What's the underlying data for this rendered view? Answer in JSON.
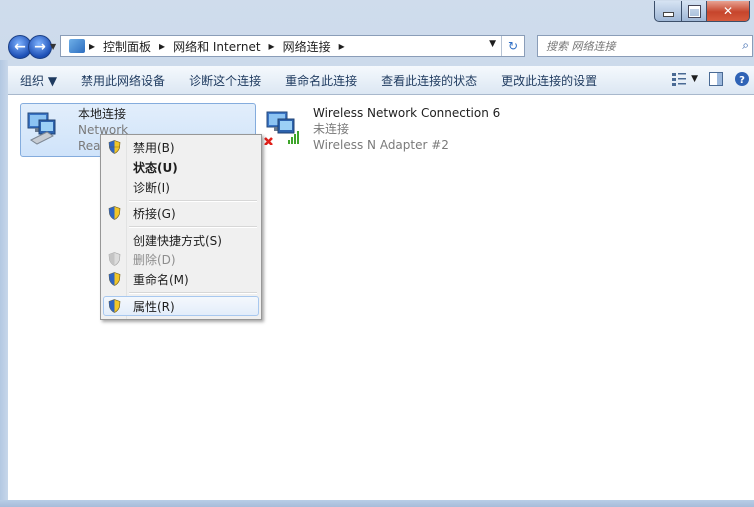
{
  "window": {
    "accent": "#2f6fc6"
  },
  "address": {
    "segments": [
      "控制面板",
      "网络和 Internet",
      "网络连接"
    ]
  },
  "search": {
    "placeholder": "搜索 网络连接"
  },
  "toolbar": {
    "organize": "组织 ▼",
    "disable": "禁用此网络设备",
    "diagnose": "诊断这个连接",
    "rename": "重命名此连接",
    "status": "查看此连接的状态",
    "settings": "更改此连接的设置"
  },
  "connections": [
    {
      "name": "本地连接",
      "status": "Network",
      "adapter": "Realtek",
      "adapter_visible": "Real"
    },
    {
      "name": "Wireless Network Connection 6",
      "status": "未连接",
      "adapter": "Wireless N Adapter #2"
    }
  ],
  "context_menu": {
    "items": [
      {
        "label": "禁用(B)",
        "shield": true,
        "bold": false,
        "disabled": false
      },
      {
        "label": "状态(U)",
        "shield": false,
        "bold": true,
        "disabled": false
      },
      {
        "label": "诊断(I)",
        "shield": false,
        "bold": false,
        "disabled": false
      },
      {
        "label": "桥接(G)",
        "shield": true,
        "bold": false,
        "disabled": false
      },
      {
        "label": "创建快捷方式(S)",
        "shield": false,
        "bold": false,
        "disabled": false
      },
      {
        "label": "删除(D)",
        "shield": true,
        "bold": false,
        "disabled": true
      },
      {
        "label": "重命名(M)",
        "shield": true,
        "bold": false,
        "disabled": false
      },
      {
        "label": "属性(R)",
        "shield": true,
        "bold": false,
        "disabled": false
      }
    ]
  }
}
